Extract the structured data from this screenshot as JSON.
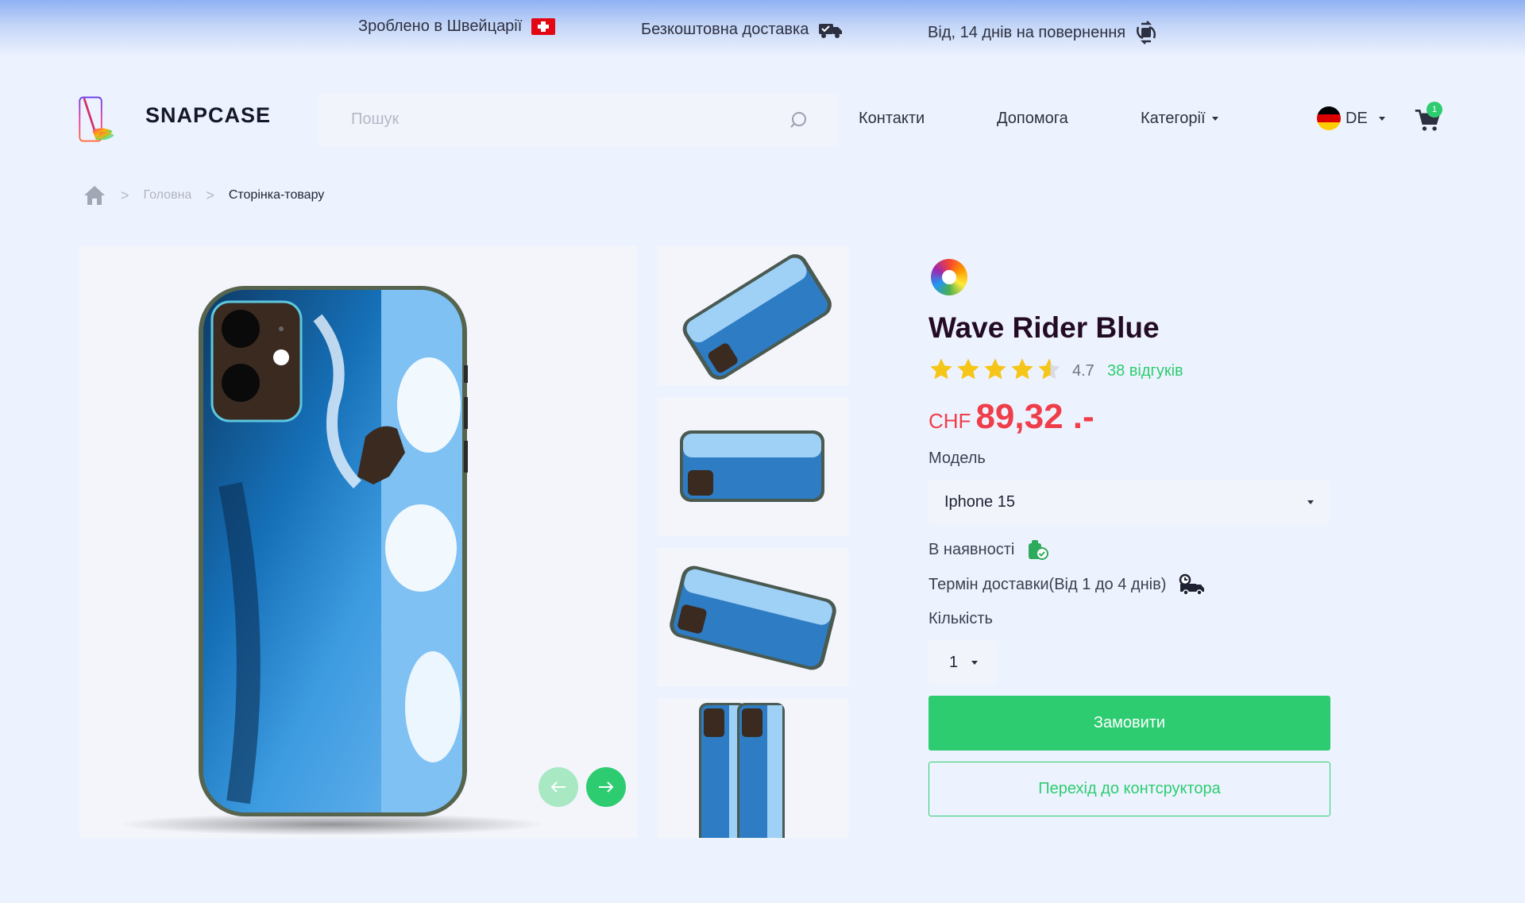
{
  "topbar": {
    "made_in": "Зроблено в Швейцарії",
    "free_delivery": "Безкоштовна доставка",
    "returns": "Від, 14 днів на повернення"
  },
  "header": {
    "logo_text": "SNAPCASE",
    "search_placeholder": "Пошук",
    "nav": {
      "contacts": "Контакти",
      "help": "Допомога",
      "categories": "Категорії"
    },
    "language": "DE",
    "cart_count": "1"
  },
  "breadcrumb": {
    "home": "Головна",
    "current": "Сторінка-товару"
  },
  "product": {
    "title": "Wave Rider Blue",
    "rating": "4.7",
    "rating_value": 4.7,
    "reviews": "38 відгуків",
    "currency": "CHF",
    "price": "89,32 .-",
    "model_label": "Модель",
    "model_value": "Iphone 15",
    "stock": "В наявності",
    "delivery": "Термін доставки(Від 1 до 4 днів)",
    "quantity_label": "Кількість",
    "quantity_value": "1",
    "order_button": "Замовити",
    "constructor_button": "Перехід до контсруктора"
  },
  "colors": {
    "accent": "#2ecc71",
    "price": "#ef3e4a",
    "title": "#240b25",
    "star": "#f5c518"
  }
}
